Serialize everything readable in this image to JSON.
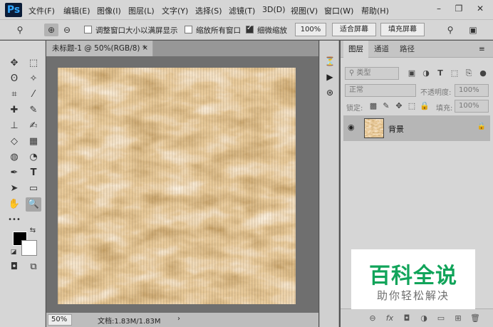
{
  "app": {
    "logo": "Ps"
  },
  "menu": [
    "文件(F)",
    "编辑(E)",
    "图像(I)",
    "图层(L)",
    "文字(Y)",
    "选择(S)",
    "滤镜(T)",
    "3D(D)",
    "视图(V)",
    "窗口(W)",
    "帮助(H)"
  ],
  "window_controls": {
    "minimize": "–",
    "restore": "❐",
    "close": "✕"
  },
  "options_bar": {
    "resize_windows_label": "调整窗口大小以满屏显示",
    "resize_windows_checked": false,
    "zoom_all_label": "缩放所有窗口",
    "zoom_all_checked": false,
    "scrubby_zoom_label": "细微缩放",
    "scrubby_zoom_checked": true,
    "btn_100": "100%",
    "btn_fit": "适合屏幕",
    "btn_fill": "填充屏幕"
  },
  "document": {
    "tab_title": "未标题-1 @ 50%(RGB/8) *",
    "tab_close": "×",
    "zoom": "50%",
    "doc_info": "文档:1.83M/1.83M",
    "status_arrow": "›",
    "texture_colors": {
      "light": "#fbe6c5",
      "mid": "#d19a58",
      "dark": "#6a3d14"
    }
  },
  "panel": {
    "tabs": [
      "图层",
      "通道",
      "路径"
    ],
    "active_tab": "图层",
    "kind_filter": "类型",
    "blend_mode": "正常",
    "opacity_label": "不透明度:",
    "opacity_value": "100%",
    "lock_label": "锁定:",
    "fill_label": "填充:",
    "fill_value": "100%",
    "layers": [
      {
        "name": "背景",
        "visible": true,
        "locked": true
      }
    ]
  },
  "watermark": {
    "main": "百科全说",
    "sub": "助你轻松解决"
  },
  "icons": {
    "search": "⚲",
    "zoom_in": "⊕",
    "zoom_out": "⊖",
    "workspace": "▣",
    "panel_menu": "≡",
    "move": "✥",
    "marquee": "⬚",
    "lasso": "ʘ",
    "wand": "✧",
    "crop": "⌗",
    "eyedropper": "⁄",
    "healing": "✚",
    "brush": "✎",
    "stamp": "⊥",
    "history_brush": "✍",
    "eraser": "◇",
    "gradient": "▦",
    "blur": "◍",
    "dodge": "◔",
    "pen": "✒",
    "type": "T",
    "path_select": "➤",
    "rectangle": "▭",
    "hand": "✋",
    "zoom": "🔍",
    "more": "•••",
    "swap": "⇆",
    "default_colors": "◪",
    "quick_mask": "◘",
    "screen_mode": "⧉",
    "dock_history": "⏳",
    "dock_play": "▶",
    "dock_3d": "⊛",
    "eye": "◉",
    "lock": "🔒",
    "link": "⊖",
    "fx": "fx",
    "mask": "◘",
    "adjustment": "◑",
    "group": "▭",
    "new_layer": "⊞",
    "delete": "🗑"
  }
}
